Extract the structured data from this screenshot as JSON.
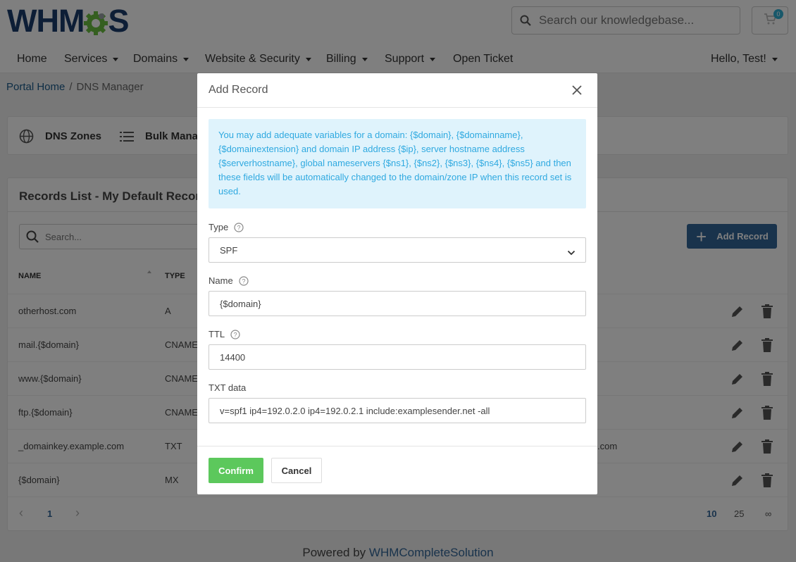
{
  "brand": {
    "logo_left": "WHM",
    "logo_right": "S"
  },
  "header": {
    "search_placeholder": "Search our knowledgebase...",
    "cart_count": "0"
  },
  "nav": {
    "items": [
      "Home",
      "Services",
      "Domains",
      "Website & Security",
      "Billing",
      "Support",
      "Open Ticket"
    ],
    "user": "Hello, Test!"
  },
  "breadcrumb": {
    "home": "Portal Home",
    "sep": "/",
    "current": "DNS Manager"
  },
  "tabs": [
    "DNS Zones",
    "Bulk Manag"
  ],
  "records": {
    "title": "Records List - My Default Record Se",
    "search_placeholder": "Search...",
    "add_label": "Add Record",
    "col_name": "NAME",
    "col_type": "TYPE",
    "rows": [
      {
        "name": "otherhost.com",
        "type": "A",
        "extra": ""
      },
      {
        "name": "mail.{$domain}",
        "type": "CNAME",
        "extra": ""
      },
      {
        "name": "www.{$domain}",
        "type": "CNAME",
        "extra": ""
      },
      {
        "name": "ftp.{$domain}",
        "type": "CNAME",
        "extra": ""
      },
      {
        "name": "_domainkey.example.com",
        "type": "TXT",
        "extra": ".com"
      },
      {
        "name": "{$domain}",
        "type": "MX",
        "extra": ""
      }
    ],
    "pagination": {
      "prev": "‹",
      "page": "1",
      "next": "›",
      "sizes": [
        "10",
        "25",
        "∞"
      ]
    }
  },
  "footer": {
    "powered_by": "Powered by",
    "link": "WHMCompleteSolution"
  },
  "modal": {
    "title": "Add Record",
    "info": "You may add adequate variables for a domain: {$domain}, {$domainname}, {$domainextension} and domain IP address {$ip}, server hostname address {$serverhostname}, global nameservers {$ns1}, {$ns2}, {$ns3}, {$ns4}, {$ns5} and then these fields will be automatically changed to the domain/zone IP when this record set is used.",
    "type_label": "Type",
    "type_value": "SPF",
    "name_label": "Name",
    "name_value": "{$domain}",
    "ttl_label": "TTL",
    "ttl_value": "14400",
    "txt_label": "TXT data",
    "txt_value": "v=spf1 ip4=192.0.2.0 ip4=192.0.2.1 include:examplesender.net -all",
    "confirm_label": "Confirm",
    "cancel_label": "Cancel"
  },
  "colors": {
    "brand_dark": "#1b3d6d",
    "brand_green": "#6abf40",
    "primary": "#336699",
    "success": "#5cc85c",
    "info_bg": "#dff3fc",
    "info_text": "#2fa9e0"
  }
}
